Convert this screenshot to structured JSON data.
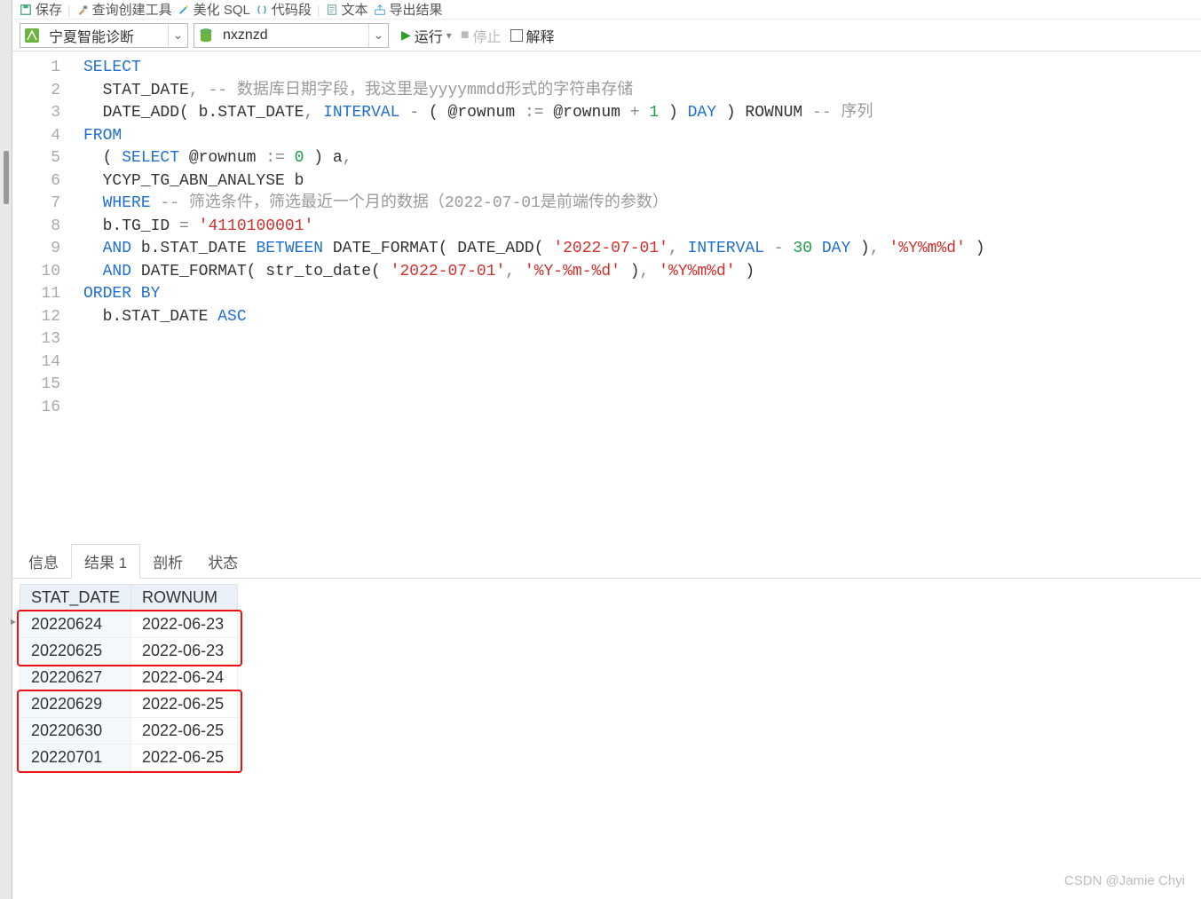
{
  "toolbar_top": {
    "save": "保存",
    "query_builder": "查询创建工具",
    "beautify": "美化 SQL",
    "snippet": "代码段",
    "text": "文本",
    "export": "导出结果"
  },
  "toolbar2": {
    "connection": "宁夏智能诊断",
    "database": "nxznzd",
    "run": "运行",
    "stop": "停止",
    "explain": "解释"
  },
  "code": {
    "lines": 16,
    "tokens": [
      [
        [
          "SELECT",
          "kw"
        ]
      ],
      [
        [
          "  STAT_DATE",
          ""
        ],
        [
          ", ",
          "op"
        ],
        [
          "-- 数据库日期字段，我这里是yyyymmdd形式的字符串存储",
          "cmt"
        ]
      ],
      [
        [
          "  DATE_ADD( b.STAT_DATE",
          ""
        ],
        [
          ", ",
          "op"
        ],
        [
          "INTERVAL",
          "kw"
        ],
        [
          " ",
          ""
        ],
        [
          "-",
          "op"
        ],
        [
          " ( @rownum ",
          ""
        ],
        [
          ":=",
          "op"
        ],
        [
          " @rownum ",
          ""
        ],
        [
          "+",
          "op"
        ],
        [
          " ",
          ""
        ],
        [
          "1",
          "num"
        ],
        [
          " ) ",
          ""
        ],
        [
          "DAY",
          "kw"
        ],
        [
          " ) ROWNUM ",
          ""
        ],
        [
          "-- 序列",
          "cmt"
        ]
      ],
      [
        [
          "FROM",
          "kw"
        ]
      ],
      [
        [
          "  ( ",
          ""
        ],
        [
          "SELECT",
          "kw"
        ],
        [
          " @rownum ",
          ""
        ],
        [
          ":=",
          "op"
        ],
        [
          " ",
          ""
        ],
        [
          "0",
          "num"
        ],
        [
          " ) a",
          ""
        ],
        [
          ",",
          "op"
        ]
      ],
      [
        [
          "  YCYP_TG_ABN_ANALYSE b",
          ""
        ]
      ],
      [
        [
          "  ",
          ""
        ],
        [
          "WHERE",
          "kw"
        ],
        [
          " ",
          ""
        ],
        [
          "-- 筛选条件，筛选最近一个月的数据（2022-07-01是前端传的参数）",
          "cmt"
        ]
      ],
      [
        [
          "  b.TG_ID ",
          ""
        ],
        [
          "=",
          "op"
        ],
        [
          " ",
          ""
        ],
        [
          "'4110100001'",
          "str"
        ]
      ],
      [
        [
          "  ",
          ""
        ],
        [
          "AND",
          "kw"
        ],
        [
          " b.STAT_DATE ",
          ""
        ],
        [
          "BETWEEN",
          "kw"
        ],
        [
          " DATE_FORMAT( DATE_ADD( ",
          ""
        ],
        [
          "'2022-07-01'",
          "str"
        ],
        [
          ", ",
          "op"
        ],
        [
          "INTERVAL",
          "kw"
        ],
        [
          " ",
          ""
        ],
        [
          "-",
          "op"
        ],
        [
          " ",
          ""
        ],
        [
          "30",
          "num"
        ],
        [
          " ",
          ""
        ],
        [
          "DAY",
          "kw"
        ],
        [
          " )",
          ""
        ],
        [
          ", ",
          "op"
        ],
        [
          "'%Y%m%d'",
          "str"
        ],
        [
          " )",
          ""
        ]
      ],
      [
        [
          "  ",
          ""
        ],
        [
          "AND",
          "kw"
        ],
        [
          " DATE_FORMAT( str_to_date( ",
          ""
        ],
        [
          "'2022-07-01'",
          "str"
        ],
        [
          ", ",
          "op"
        ],
        [
          "'%Y-%m-%d'",
          "str"
        ],
        [
          " )",
          ""
        ],
        [
          ", ",
          "op"
        ],
        [
          "'%Y%m%d'",
          "str"
        ],
        [
          " )",
          ""
        ]
      ],
      [
        [
          "ORDER BY",
          "kw"
        ]
      ],
      [
        [
          "  b.STAT_DATE ",
          ""
        ],
        [
          "ASC",
          "kw"
        ]
      ],
      [
        [
          "",
          ""
        ]
      ],
      [
        [
          "",
          ""
        ]
      ],
      [
        [
          "",
          ""
        ]
      ],
      [
        [
          "",
          ""
        ]
      ]
    ]
  },
  "tabs": {
    "info": "信息",
    "result1": "结果 1",
    "profile": "剖析",
    "status": "状态"
  },
  "result": {
    "columns": [
      "STAT_DATE",
      "ROWNUM"
    ],
    "rows": [
      [
        "20220624",
        "2022-06-23"
      ],
      [
        "20220625",
        "2022-06-23"
      ],
      [
        "20220627",
        "2022-06-24"
      ],
      [
        "20220629",
        "2022-06-25"
      ],
      [
        "20220630",
        "2022-06-25"
      ],
      [
        "20220701",
        "2022-06-25"
      ]
    ],
    "highlight_groups": [
      [
        0,
        1
      ],
      [
        3,
        5
      ]
    ]
  },
  "watermark": "CSDN @Jamie Chyi"
}
